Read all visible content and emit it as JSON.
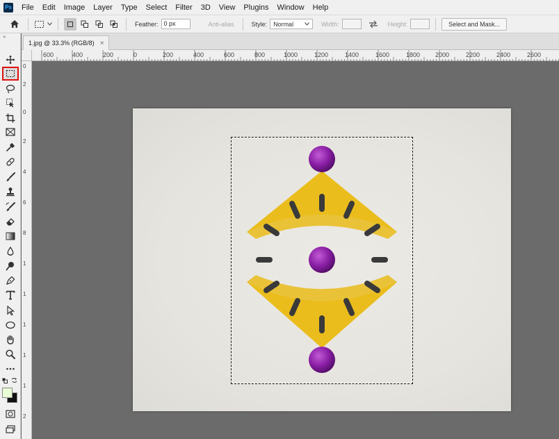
{
  "app": {
    "logo_text": "Ps"
  },
  "menu": [
    "File",
    "Edit",
    "Image",
    "Layer",
    "Type",
    "Select",
    "Filter",
    "3D",
    "View",
    "Plugins",
    "Window",
    "Help"
  ],
  "options": {
    "feather_label": "Feather:",
    "feather_value": "0 px",
    "antialias_label": "Anti-alias",
    "style_label": "Style:",
    "style_value": "Normal",
    "width_label": "Width:",
    "height_label": "Height:",
    "select_mask_label": "Select and Mask..."
  },
  "document": {
    "tab_title": "1.jpg @ 33.3% (RGB/8)",
    "close_symbol": "×"
  },
  "ruler_h": [
    "600",
    "400",
    "200",
    "0",
    "200",
    "400",
    "600",
    "800",
    "1000",
    "1200",
    "1400",
    "1600",
    "1800",
    "2000",
    "2200",
    "2400",
    "2600"
  ],
  "ruler_v": [
    "0",
    "2",
    "0",
    "2",
    "4",
    "6",
    "8",
    "1",
    "1",
    "1",
    "1",
    "1",
    "2"
  ],
  "toolbox": {
    "tools": [
      "move-tool",
      "rectangular-marquee-tool",
      "lasso-tool",
      "object-selection-tool",
      "crop-tool",
      "frame-tool",
      "eyedropper-tool",
      "healing-brush-tool",
      "brush-tool",
      "clone-stamp-tool",
      "history-brush-tool",
      "eraser-tool",
      "gradient-tool",
      "blur-tool",
      "dodge-tool",
      "pen-tool",
      "type-tool",
      "path-selection-tool",
      "ellipse-tool",
      "hand-tool",
      "zoom-tool",
      "more-tools"
    ],
    "selected": "rectangular-marquee-tool",
    "foreground_color": "#e8ffd6",
    "background_color": "#111111"
  },
  "colors": {
    "yellow": "#f0c419",
    "purple": "#8a1fa5",
    "dark": "#3a3a3a"
  }
}
